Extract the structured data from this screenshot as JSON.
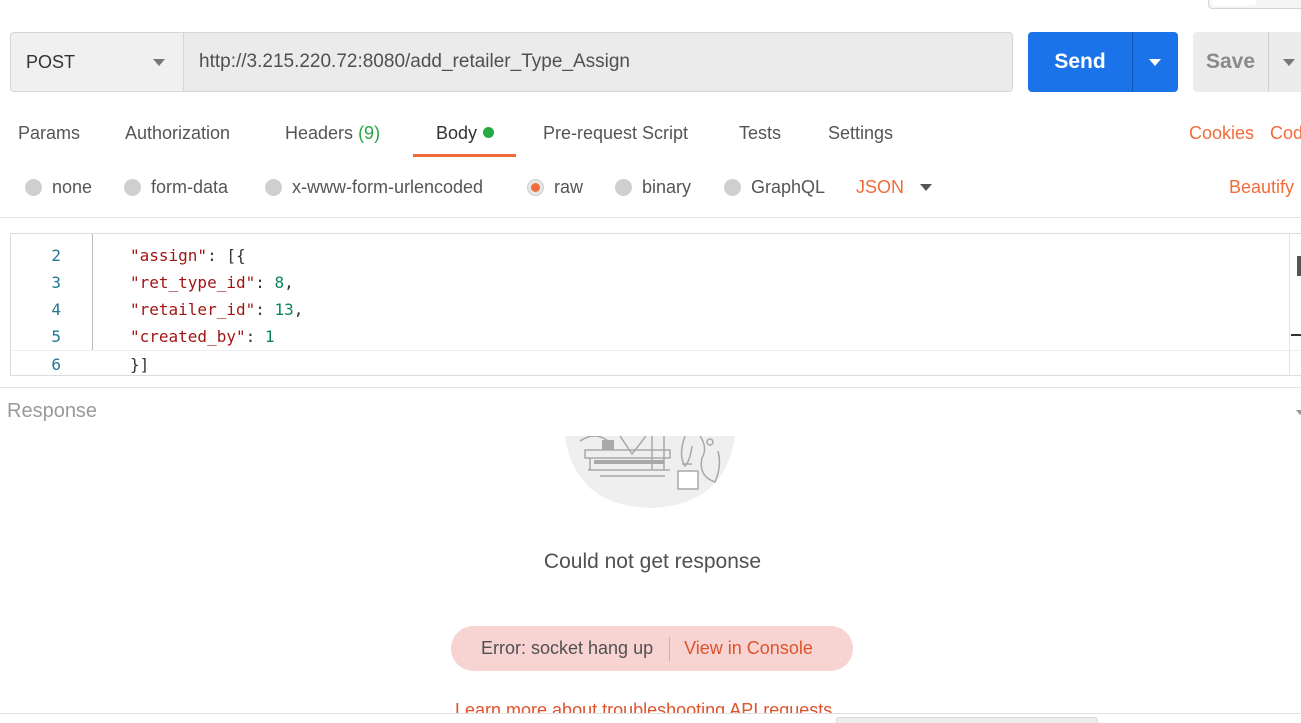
{
  "request": {
    "method": "POST",
    "url": "http://3.215.220.72:8080/add_retailer_Type_Assign",
    "send_label": "Send",
    "save_label": "Save"
  },
  "tabs": [
    {
      "label": "Params"
    },
    {
      "label": "Authorization"
    },
    {
      "label": "Headers",
      "count": "(9)"
    },
    {
      "label": "Body"
    },
    {
      "label": "Pre-request Script"
    },
    {
      "label": "Tests"
    },
    {
      "label": "Settings"
    }
  ],
  "tab_links": {
    "cookies": "Cookies",
    "code": "Cod"
  },
  "body_types": [
    {
      "label": "none"
    },
    {
      "label": "form-data"
    },
    {
      "label": "x-www-form-urlencoded"
    },
    {
      "label": "raw",
      "selected": true
    },
    {
      "label": "binary"
    },
    {
      "label": "GraphQL"
    }
  ],
  "language": "JSON",
  "beautify_label": "Beautify",
  "editor": {
    "lines": [
      {
        "num": "2",
        "key": "\"assign\"",
        "rest": ": [{"
      },
      {
        "num": "3",
        "key": "\"ret_type_id\"",
        "rest": ": ",
        "value": "8",
        "tail": ","
      },
      {
        "num": "4",
        "key": "\"retailer_id\"",
        "rest": ": ",
        "value": "13",
        "tail": ","
      },
      {
        "num": "5",
        "key": "\"created_by\"",
        "rest": ": ",
        "value": "1",
        "tail": ""
      },
      {
        "num": "6",
        "code": "}]"
      }
    ]
  },
  "response": {
    "title": "Response",
    "message": "Could not get response",
    "error": "Error: socket hang up",
    "console_link": "View in Console",
    "learn_more": "Learn more about troubleshooting API requests"
  },
  "colors": {
    "accent": "#f26b3a",
    "primary": "#1a73e8",
    "success": "#26a843",
    "error_bg": "#f7d3d2"
  }
}
